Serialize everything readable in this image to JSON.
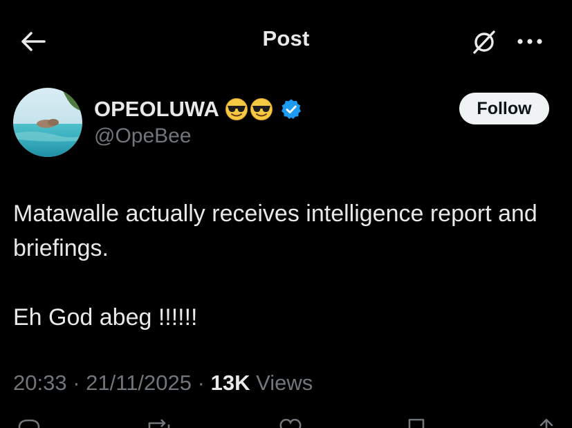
{
  "header": {
    "title": "Post",
    "back_icon": "arrow-left-icon",
    "grok_icon": "grok-icon",
    "more_icon": "more-horizontal-icon"
  },
  "author": {
    "display_name": "OPEOLUWA",
    "emojis": [
      "😎",
      "😎"
    ],
    "verified_icon": "verified-badge-icon",
    "verified_color": "#1d9bf0",
    "handle": "@OpeBee",
    "follow_label": "Follow"
  },
  "tweet": {
    "lines": [
      "Matawalle actually receives intelligence report and briefings.",
      "Eh God abeg !!!!!!"
    ]
  },
  "meta": {
    "time": "20:33",
    "separator": "·",
    "date": "21/11/2025",
    "views_count": "13K",
    "views_label": "Views"
  },
  "colors": {
    "background": "#000000",
    "primary_text": "#e7e9ea",
    "secondary_text": "#71767b",
    "follow_bg": "#eff3f4"
  },
  "actions": [
    "reply-icon",
    "repost-icon",
    "like-icon",
    "bookmark-icon",
    "share-icon"
  ]
}
